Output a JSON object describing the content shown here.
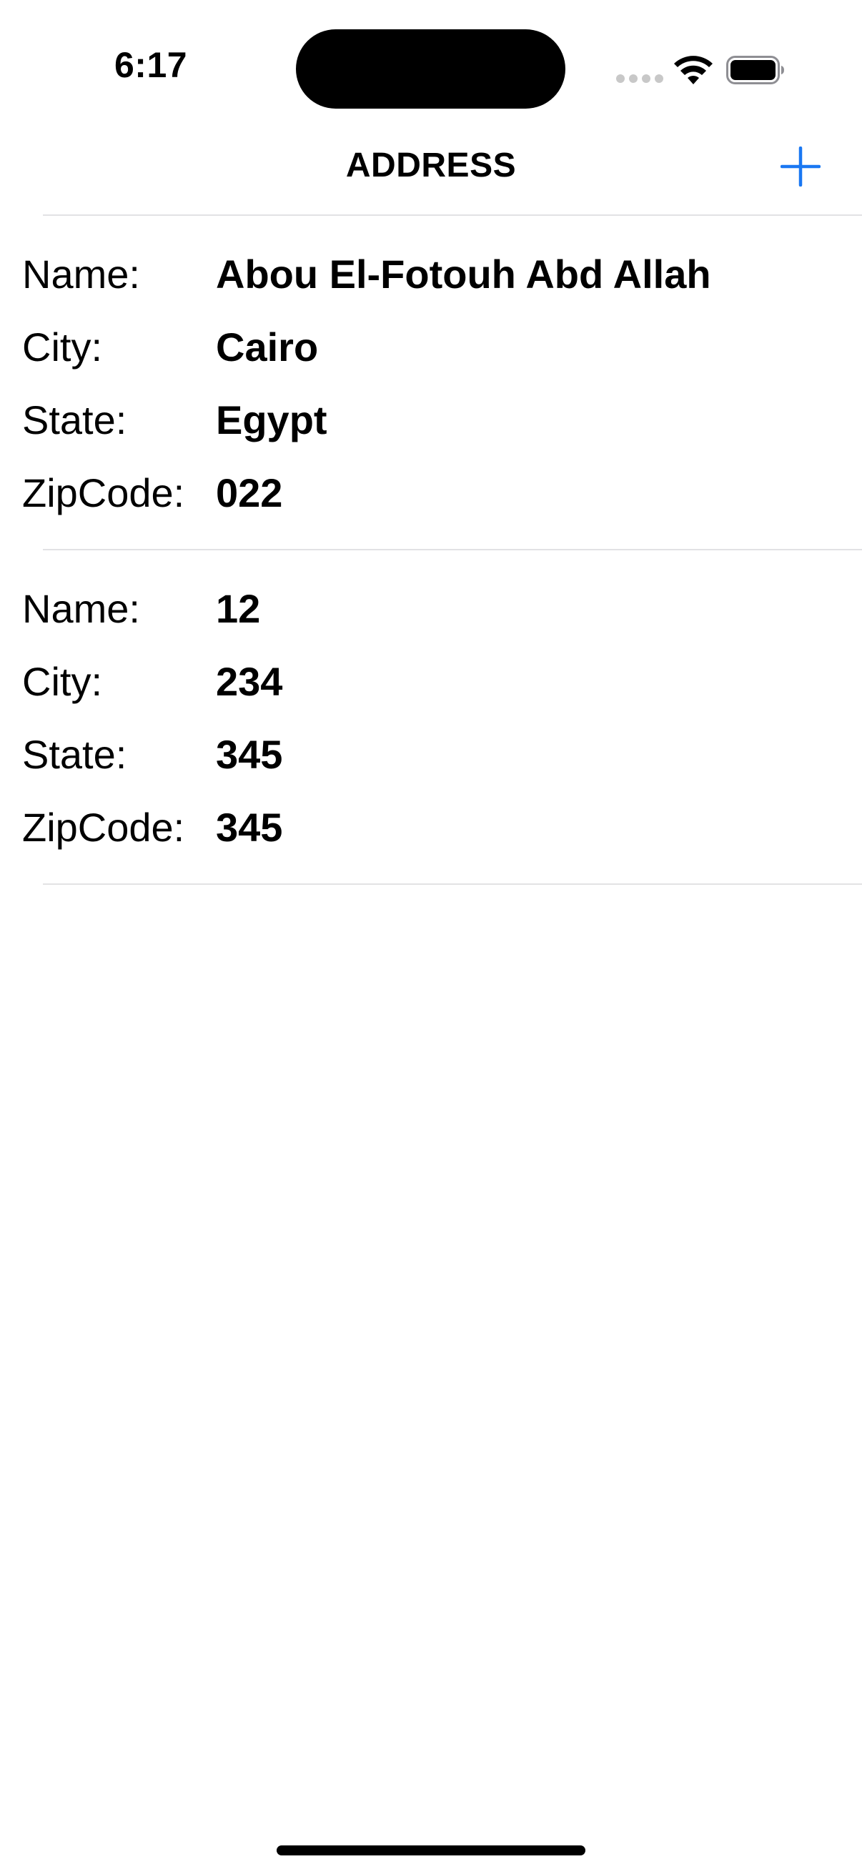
{
  "status_bar": {
    "time": "6:17"
  },
  "nav": {
    "title": "ADDRESS",
    "add_icon": "plus-icon",
    "accent_color": "#1a78f2"
  },
  "addresses": [
    {
      "name_label": "Name:",
      "name": "Abou El-Fotouh Abd Allah",
      "city_label": "City:",
      "city": "Cairo",
      "state_label": "State:",
      "state": "Egypt",
      "zip_label": "ZipCode:",
      "zip": "022"
    },
    {
      "name_label": "Name:",
      "name": "12",
      "city_label": "City:",
      "city": "234",
      "state_label": "State:",
      "state": "345",
      "zip_label": "ZipCode:",
      "zip": "345"
    }
  ]
}
